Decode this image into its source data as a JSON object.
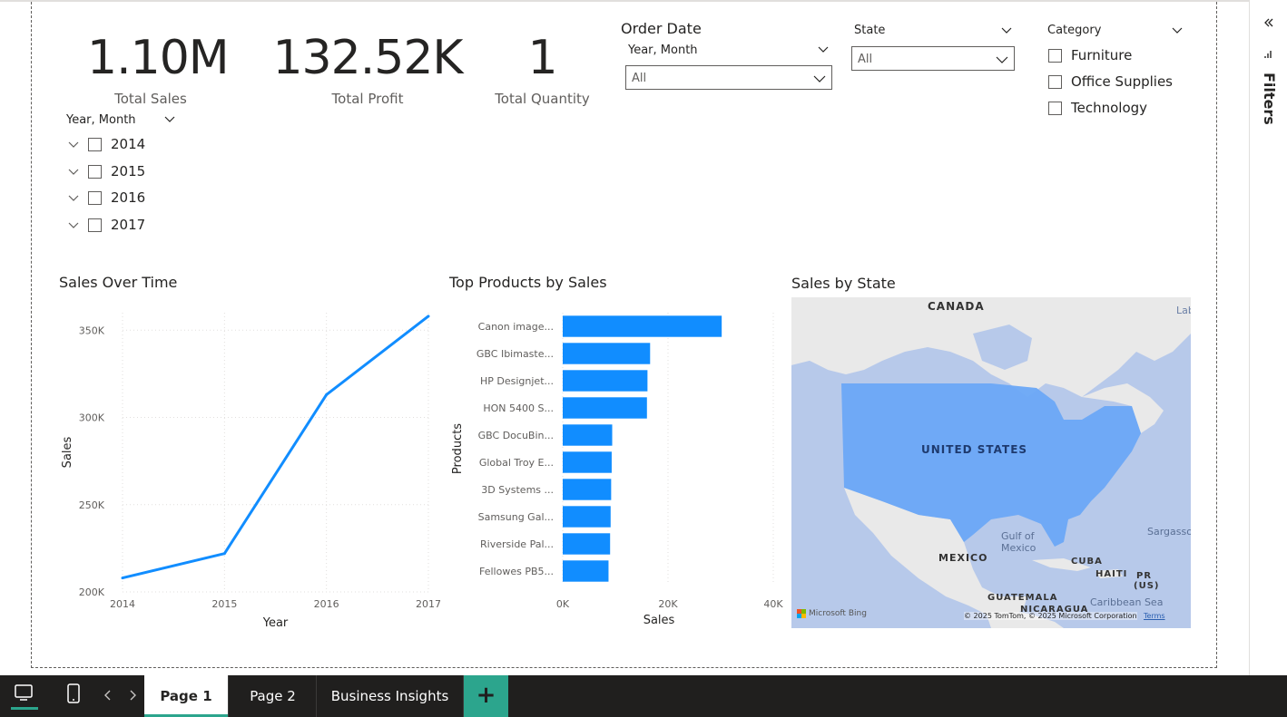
{
  "kpis": [
    {
      "value": "1.10M",
      "label": "Total Sales"
    },
    {
      "value": "132.52K",
      "label": "Total Profit"
    },
    {
      "value": "1",
      "label": "Total Quantity"
    }
  ],
  "slicers": {
    "year_month_tree": {
      "title": "Year, Month",
      "items": [
        "2014",
        "2015",
        "2016",
        "2017"
      ]
    },
    "order_date": {
      "title": "Order Date",
      "subtitle": "Year, Month",
      "value": "All"
    },
    "state": {
      "title": "State",
      "value": "All"
    },
    "category": {
      "title": "Category",
      "items": [
        "Furniture",
        "Office Supplies",
        "Technology"
      ]
    }
  },
  "line_chart": {
    "title": "Sales Over Time",
    "chart_data": {
      "type": "line",
      "x": [
        "2014",
        "2015",
        "2016",
        "2017"
      ],
      "values": [
        208000,
        222000,
        313000,
        358000
      ],
      "xlabel": "Year",
      "ylabel": "Sales",
      "ylim": [
        200000,
        360000
      ],
      "yticks": [
        "200K",
        "250K",
        "300K",
        "350K"
      ],
      "color": "#118dff"
    }
  },
  "bar_chart": {
    "title": "Top Products by Sales",
    "chart_data": {
      "type": "bar",
      "orientation": "horizontal",
      "categories": [
        "Canon image...",
        "GBC Ibimaste...",
        "HP Designjet...",
        "HON 5400 S...",
        "GBC DocuBin...",
        "Global Troy E...",
        "3D Systems ...",
        "Samsung Gal...",
        "Riverside Pal...",
        "Fellowes PB5..."
      ],
      "values": [
        30200,
        16600,
        16100,
        16000,
        9400,
        9300,
        9200,
        9100,
        9000,
        8700
      ],
      "xlabel": "Sales",
      "ylabel": "Products",
      "xlim": [
        0,
        40000
      ],
      "xticks": [
        "0K",
        "20K",
        "40K"
      ],
      "color": "#118dff"
    }
  },
  "map": {
    "title": "Sales by State",
    "labels": {
      "canada": "CANADA",
      "us": "UNITED STATES",
      "mexico": "MEXICO",
      "gulf": "Gulf of",
      "gulf2": "Mexico",
      "cuba": "CUBA",
      "haiti": "HAITI",
      "pr": "PR",
      "pr2": "(US)",
      "guatemala": "GUATEMALA",
      "nicaragua": "NICARAGUA",
      "caribbean": "Caribbean Sea",
      "sargasso": "Sargasso",
      "lab": "Lab",
      "bing": "Microsoft Bing",
      "copyright": "© 2025 TomTom, © 2025 Microsoft Corporation",
      "terms": "Terms"
    },
    "colors": {
      "sea": "#b7c9ea",
      "land": "#e9e9e9",
      "us": "#6aa8f7"
    }
  },
  "filters_pane": {
    "label": "Filters"
  },
  "tabs": [
    {
      "label": "Page 1",
      "active": true
    },
    {
      "label": "Page 2",
      "active": false
    },
    {
      "label": "Business Insights",
      "active": false
    }
  ],
  "add_tab": "+"
}
